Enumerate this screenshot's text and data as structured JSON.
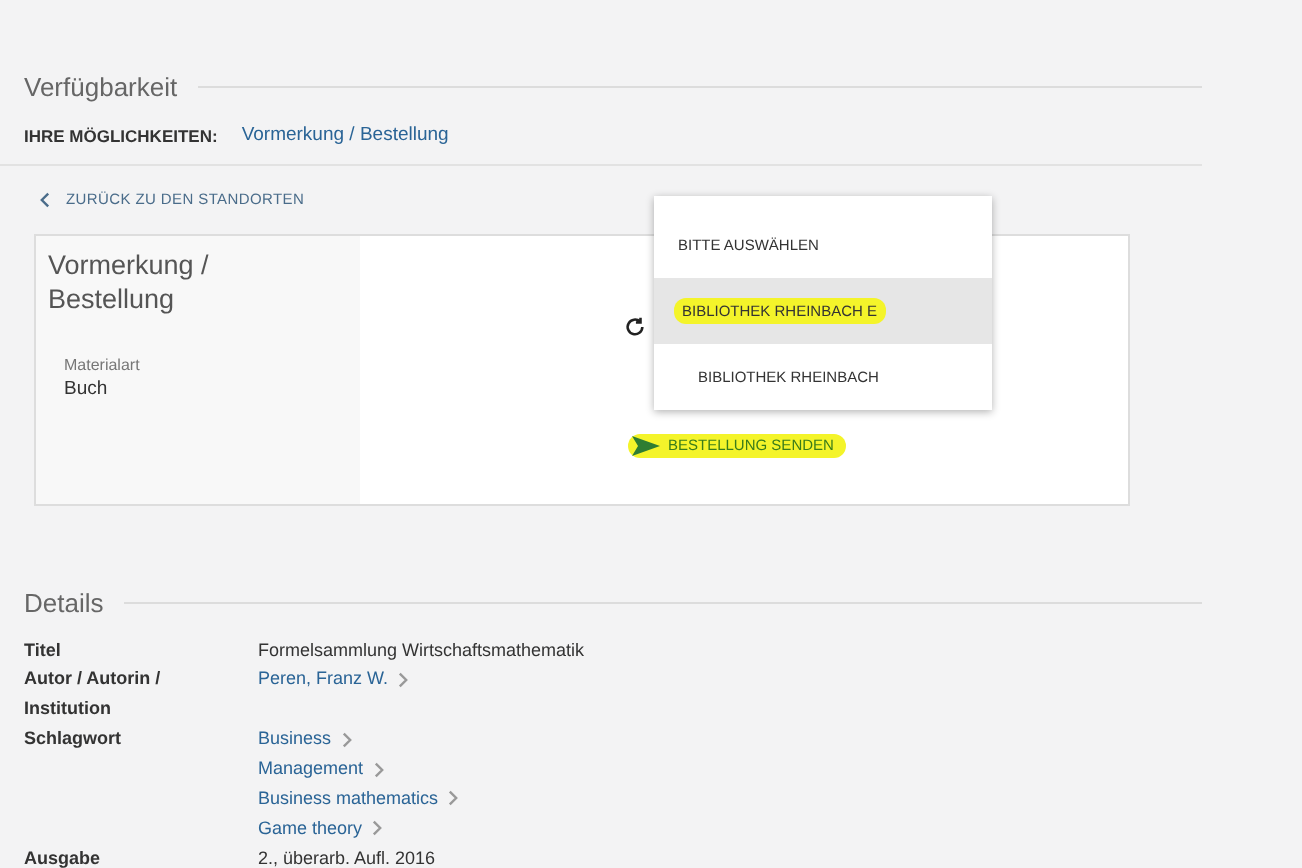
{
  "availability": {
    "heading": "Verfügbarkeit",
    "options_label": "IHRE MÖGLICHKEITEN:",
    "options_link": "Vormerkung / Bestellung",
    "back_link": "ZURÜCK ZU DEN STANDORTEN"
  },
  "request_card": {
    "title": "Vormerkung / Bestellung",
    "field_label": "Materialart",
    "field_value": "Buch",
    "send_button": {
      "label": "BESTELLUNG SENDEN",
      "highlighted": true
    }
  },
  "dropdown": {
    "options": [
      {
        "label": "BITTE AUSWÄHLEN",
        "selected": false,
        "highlighted": false
      },
      {
        "label": "BIBLIOTHEK RHEINBACH E",
        "selected": true,
        "highlighted": true
      },
      {
        "label": "BIBLIOTHEK RHEINBACH",
        "selected": false,
        "highlighted": false
      }
    ]
  },
  "details": {
    "heading": "Details",
    "rows": [
      {
        "label": "Titel",
        "values": [
          {
            "text": "Formelsammlung Wirtschaftsmathematik",
            "link": false
          }
        ]
      },
      {
        "label": "Autor / Autorin / Institution",
        "values": [
          {
            "text": "Peren, Franz W.",
            "link": true
          }
        ]
      },
      {
        "label": "Schlagwort",
        "values": [
          {
            "text": "Business",
            "link": true
          },
          {
            "text": "Management",
            "link": true
          },
          {
            "text": "Business mathematics",
            "link": true
          },
          {
            "text": "Game theory",
            "link": true
          }
        ]
      },
      {
        "label": "Ausgabe",
        "values": [
          {
            "text": "2., überarb. Aufl. 2016",
            "link": false
          }
        ]
      }
    ]
  }
}
